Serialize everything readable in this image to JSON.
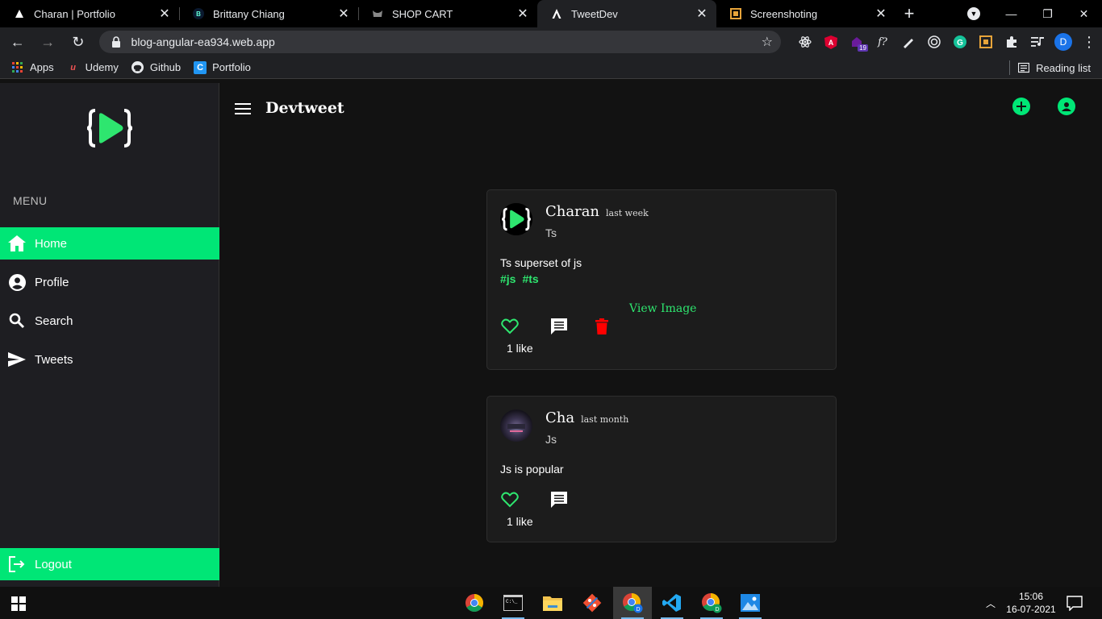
{
  "browser": {
    "tabs": [
      {
        "title": "Charan | Portfolio",
        "favicon": "triangle-logo-icon"
      },
      {
        "title": "Brittany Chiang",
        "favicon": "b-logo-icon"
      },
      {
        "title": "SHOP CART",
        "favicon": "cart-logo-icon"
      },
      {
        "title": "TweetDev",
        "favicon": "angular-logo-icon",
        "active": true
      },
      {
        "title": "Screenshoting",
        "favicon": "screenshot-logo-icon"
      }
    ],
    "url": "blog-angular-ea934.web.app",
    "profile_initial": "D",
    "ext_badge": "19",
    "bookmarks": [
      {
        "label": "Apps",
        "icon": "apps-grid-icon"
      },
      {
        "label": "Udemy",
        "icon": "udemy-icon"
      },
      {
        "label": "Github",
        "icon": "github-icon"
      },
      {
        "label": "Portfolio",
        "icon": "portfolio-icon"
      }
    ],
    "reading_list": "Reading list"
  },
  "app": {
    "title": "Devtweet",
    "accent_color": "#00e676",
    "menu_label": "MENU",
    "nav": [
      {
        "label": "Home",
        "icon": "home-icon",
        "active": true
      },
      {
        "label": "Profile",
        "icon": "account-circle-icon"
      },
      {
        "label": "Search",
        "icon": "search-icon"
      },
      {
        "label": "Tweets",
        "icon": "send-icon"
      }
    ],
    "logout": "Logout"
  },
  "tweets": [
    {
      "name": "Charan",
      "time": "last week",
      "handle": "Ts",
      "text": "Ts superset of js",
      "tags": [
        "#js",
        "#ts"
      ],
      "view_image": "View Image",
      "likes": "1 like",
      "deletable": true
    },
    {
      "name": "Cha",
      "time": "last month",
      "handle": "Js",
      "text": "Js is popular",
      "tags": [],
      "likes": "1 like",
      "deletable": false
    }
  ],
  "taskbar": {
    "time": "15:06",
    "date": "16-07-2021"
  }
}
